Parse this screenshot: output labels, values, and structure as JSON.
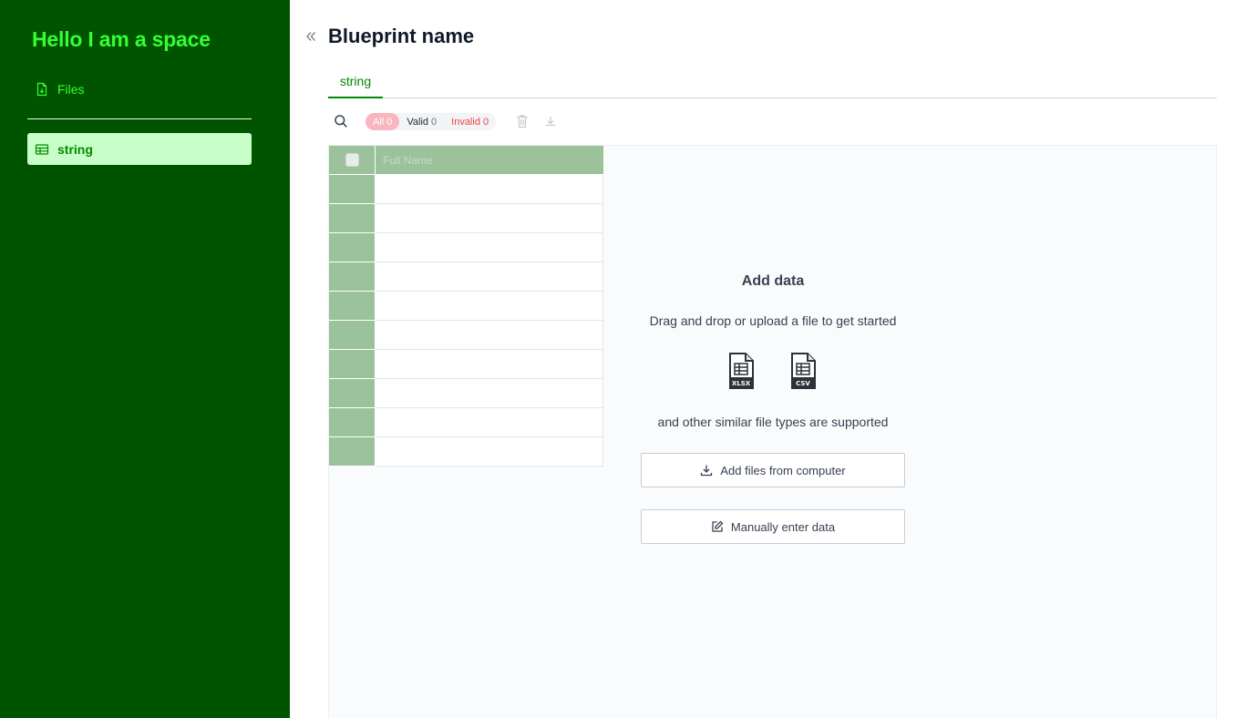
{
  "sidebar": {
    "space_title": "Hello I am a space",
    "files_label": "Files",
    "sheets": [
      {
        "label": "string"
      }
    ]
  },
  "header": {
    "title": "Blueprint name"
  },
  "tabs": [
    {
      "label": "string",
      "active": true
    }
  ],
  "toolbar": {
    "filters": {
      "all": {
        "label": "All",
        "count": "0"
      },
      "valid": {
        "label": "Valid",
        "count": "0"
      },
      "invalid": {
        "label": "Invalid",
        "count": "0"
      }
    }
  },
  "table": {
    "columns": [
      "Full Name"
    ],
    "empty_rows": 10
  },
  "empty_state": {
    "title": "Add data",
    "subtitle": "Drag and drop or upload a file to get started",
    "file_types": [
      "XLSX",
      "CSV"
    ],
    "note": "and other similar file types are supported",
    "upload_label": "Add files from computer",
    "manual_label": "Manually enter data"
  },
  "colors": {
    "sidebar_bg": "#005400",
    "accent": "#008a00",
    "title_green": "#33ff33",
    "active_nav_bg": "#c8ffc8",
    "header_row_bg": "#9bc29b",
    "invalid_red": "#ef4444"
  }
}
